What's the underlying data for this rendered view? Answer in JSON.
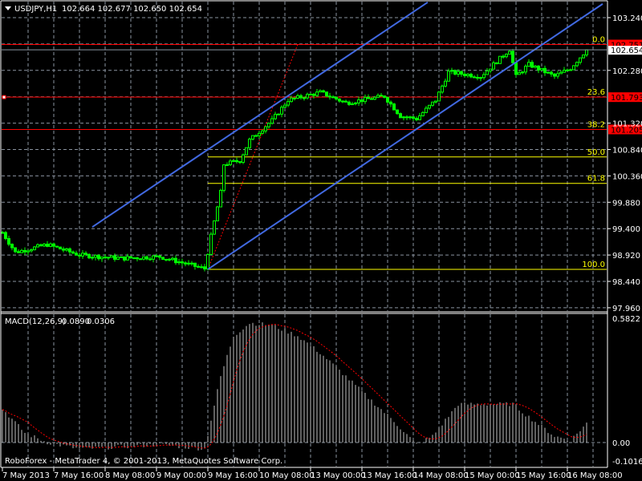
{
  "header": {
    "symbol": "USDJPY,H1",
    "ohlc": "102.664 102.677 102.650 102.654"
  },
  "macd_label": {
    "name": "MACD(12,26,9)",
    "main": "0.0890",
    "signal": "0.0306"
  },
  "copyright": "RoboForex - MetaTrader 4, © 2001-2013, MetaQuotes Software Corp.",
  "price_axis": [
    "103.240",
    "102.280",
    "101.320",
    "100.840",
    "100.360",
    "99.880",
    "99.400",
    "98.920",
    "98.440",
    "97.960"
  ],
  "macd_axis": {
    "max": "0.5822",
    "zero": "0.00",
    "min": "-0.1016"
  },
  "time_axis": [
    "7 May 2013",
    "7 May 16:00",
    "8 May 08:00",
    "9 May 00:00",
    "9 May 16:00",
    "10 May 08:00",
    "13 May 00:00",
    "13 May 16:00",
    "14 May 08:00",
    "15 May 00:00",
    "15 May 16:00",
    "16 May 08:00"
  ],
  "current_price": "102.654",
  "fibo": [
    {
      "level": "0.0",
      "price": 102.751,
      "label": "102.751",
      "color": "#ff0000"
    },
    {
      "level": "23.6",
      "price": 101.793,
      "label": "101.793",
      "color": "#ff0000"
    },
    {
      "level": "38.2",
      "price": 101.205,
      "label": "101.205",
      "color": "#ff0000"
    },
    {
      "level": "50.0",
      "price": 100.705,
      "color": "#ffff00"
    },
    {
      "level": "61.8",
      "price": 100.224,
      "color": "#ffff00"
    },
    {
      "level": "100.0",
      "price": 98.659,
      "color": "#ffff00"
    }
  ],
  "colors": {
    "bg": "#000000",
    "grid": "#8a93a0",
    "candle": "#00ff00",
    "channel": "#4169e1",
    "fibo_red": "#ff0000",
    "fibo_yellow": "#ffff00",
    "axis_text": "#ffffff",
    "macd_hist": "#c0c0c0",
    "macd_signal": "#ff0000"
  },
  "chart_data": {
    "type": "candlestick",
    "symbol": "USDJPY",
    "timeframe": "H1",
    "ylim": [
      97.96,
      103.24
    ],
    "price_keypoints": [
      [
        0,
        99.33
      ],
      [
        4,
        98.97
      ],
      [
        14,
        99.11
      ],
      [
        24,
        98.92
      ],
      [
        37,
        98.86
      ],
      [
        49,
        98.89
      ],
      [
        63,
        98.67
      ],
      [
        65,
        99.26
      ],
      [
        68,
        100.06
      ],
      [
        69,
        100.57
      ],
      [
        74,
        100.64
      ],
      [
        77,
        101.01
      ],
      [
        84,
        101.37
      ],
      [
        89,
        101.74
      ],
      [
        99,
        101.88
      ],
      [
        107,
        101.69
      ],
      [
        119,
        101.81
      ],
      [
        124,
        101.45
      ],
      [
        129,
        101.4
      ],
      [
        135,
        101.74
      ],
      [
        139,
        102.25
      ],
      [
        149,
        102.17
      ],
      [
        158,
        102.66
      ],
      [
        160,
        102.17
      ],
      [
        164,
        102.39
      ],
      [
        172,
        102.17
      ],
      [
        177,
        102.32
      ],
      [
        182,
        102.654
      ]
    ],
    "channel_lines": [
      {
        "from": [
          28,
          99.43
        ],
        "to": [
          132.5,
          103.52
        ]
      },
      {
        "from": [
          64,
          98.66
        ],
        "to": [
          187,
          103.49
        ]
      }
    ],
    "fibo_trend": {
      "from": [
        64,
        98.66
      ],
      "to": [
        92,
        102.751
      ]
    },
    "macd": {
      "ylim": [
        -0.1016,
        0.5822
      ],
      "hist_keypoints": [
        [
          0,
          0.158
        ],
        [
          7,
          0.045
        ],
        [
          14,
          0
        ],
        [
          24,
          -0.03
        ],
        [
          49,
          -0.01
        ],
        [
          63,
          -0.03
        ],
        [
          68,
          0.31
        ],
        [
          72,
          0.5
        ],
        [
          77,
          0.56
        ],
        [
          84,
          0.55
        ],
        [
          92,
          0.5
        ],
        [
          99,
          0.42
        ],
        [
          107,
          0.31
        ],
        [
          114,
          0.21
        ],
        [
          122,
          0.1
        ],
        [
          129,
          -0.01
        ],
        [
          134,
          0.03
        ],
        [
          142,
          0.18
        ],
        [
          149,
          0.18
        ],
        [
          159,
          0.18
        ],
        [
          164,
          0.12
        ],
        [
          172,
          0.03
        ],
        [
          177,
          0.01
        ],
        [
          182,
          0.09
        ]
      ]
    }
  }
}
